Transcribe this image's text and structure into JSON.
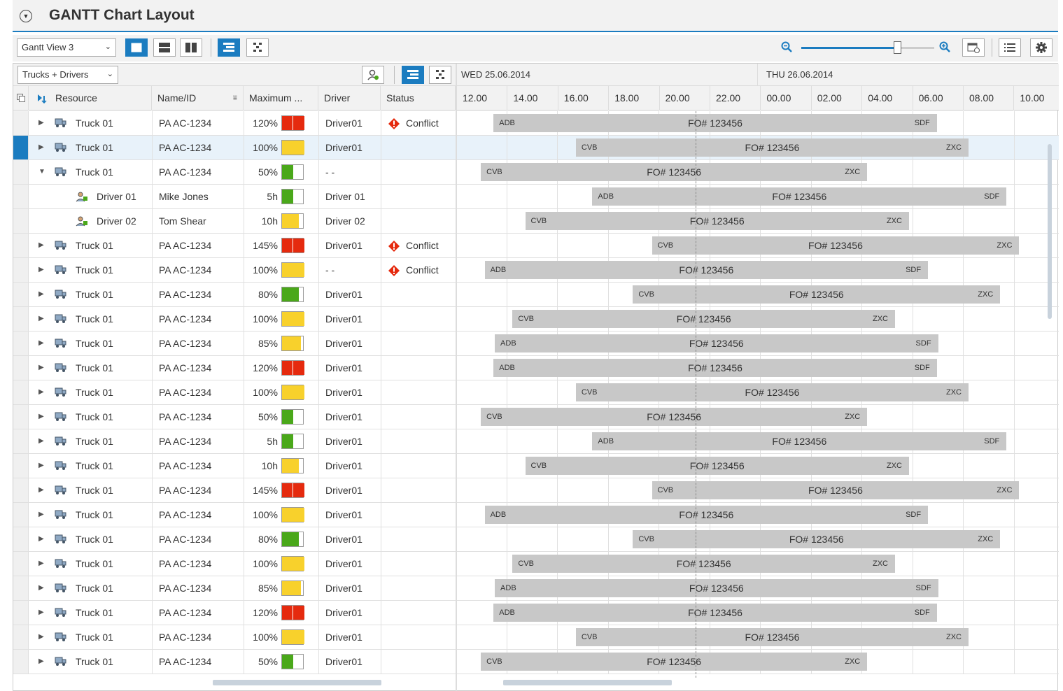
{
  "title": {
    "text": "GANTT Chart Layout",
    "toggle_icon": "chevron-down-circle-icon"
  },
  "toolbar": {
    "view_select": "Gantt View 3",
    "layout_buttons": [
      "single-panel-icon",
      "horizontal-split-icon",
      "vertical-split-icon"
    ],
    "mode_buttons": [
      "gantt-bars-icon",
      "network-icon"
    ],
    "right_icons": [
      "zoom-out-icon",
      "zoom-in-icon",
      "calendar-settings-icon",
      "list-icon",
      "settings-icon"
    ],
    "zoom_level": 0.72
  },
  "subtoolbar": {
    "filter_select": "Trucks + Drivers",
    "icons": [
      "assign-driver-icon",
      "gantt-bars-icon",
      "network-icon"
    ]
  },
  "columns": {
    "resource": "Resource",
    "name": "Name/ID",
    "maximum": "Maximum ...",
    "driver": "Driver",
    "status": "Status"
  },
  "days": [
    "WED 25.06.2014",
    "THU 26.06.2014"
  ],
  "hours": [
    "12.00",
    "14.00",
    "16.00",
    "18.00",
    "20.00",
    "22.00",
    "00.00",
    "02.00",
    "04.00",
    "06.00",
    "08.00",
    "10.00"
  ],
  "status_labels": {
    "conflict": "Conflict"
  },
  "colors": {
    "red": "#e52a0e",
    "yellow": "#f8d12c",
    "green": "#4aa81a",
    "accent": "#1b7cc0",
    "bar": "#c8c8c8"
  },
  "rows": [
    {
      "level": 0,
      "expander": "collapsed",
      "resource": "Truck 01",
      "name": "PA AC-1234",
      "max": "120%",
      "cap": "red",
      "capFill": 1.0,
      "driver": "Driver01",
      "status": "conflict",
      "bar": {
        "start": 1.25,
        "end": 18.75,
        "left": "ADB",
        "center": "FO# 123456",
        "right": "SDF"
      }
    },
    {
      "level": 0,
      "expander": "collapsed",
      "resource": "Truck 01",
      "name": "PA AC-1234",
      "max": "100%",
      "cap": "yellow",
      "capFill": 1.0,
      "driver": "Driver01",
      "status": "",
      "selected": true,
      "bar": {
        "start": 4.5,
        "end": 20.0,
        "left": "CVB",
        "center": "FO# 123456",
        "right": "ZXC"
      }
    },
    {
      "level": 0,
      "expander": "expanded",
      "resource": "Truck 01",
      "name": "PA AC-1234",
      "max": "50%",
      "cap": "green",
      "capFill": 0.5,
      "driver": "- -",
      "status": "",
      "bar": {
        "start": 0.75,
        "end": 16.0,
        "left": "CVB",
        "center": "FO# 123456",
        "right": "ZXC"
      }
    },
    {
      "level": 1,
      "expander": "none",
      "resource": "Driver 01",
      "name": "Mike Jones",
      "max": "5h",
      "cap": "green",
      "capFill": 0.5,
      "driver": "Driver 01",
      "status": "",
      "bar": {
        "start": 5.15,
        "end": 21.5,
        "left": "ADB",
        "center": "FO# 123456",
        "right": "SDF"
      }
    },
    {
      "level": 1,
      "expander": "none",
      "resource": "Driver 02",
      "name": "Tom Shear",
      "max": "10h",
      "cap": "yellow",
      "capFill": 0.75,
      "driver": "Driver 02",
      "status": "",
      "bar": {
        "start": 2.5,
        "end": 17.65,
        "left": "CVB",
        "center": "FO# 123456",
        "right": "ZXC"
      }
    },
    {
      "level": 0,
      "expander": "collapsed",
      "resource": "Truck 01",
      "name": "PA AC-1234",
      "max": "145%",
      "cap": "red",
      "capFill": 1.0,
      "driver": "Driver01",
      "status": "conflict",
      "bar": {
        "start": 7.5,
        "end": 22.0,
        "left": "CVB",
        "center": "FO# 123456",
        "right": "ZXC"
      }
    },
    {
      "level": 0,
      "expander": "collapsed",
      "resource": "Truck 01",
      "name": "PA AC-1234",
      "max": "100%",
      "cap": "yellow",
      "capFill": 1.0,
      "driver": "- -",
      "status": "conflict",
      "bar": {
        "start": 0.9,
        "end": 18.4,
        "left": "ADB",
        "center": "FO# 123456",
        "right": "SDF"
      }
    },
    {
      "level": 0,
      "expander": "collapsed",
      "resource": "Truck 01",
      "name": "PA AC-1234",
      "max": "80%",
      "cap": "green",
      "capFill": 0.75,
      "driver": "Driver01",
      "status": "",
      "bar": {
        "start": 6.75,
        "end": 21.25,
        "left": "CVB",
        "center": "FO# 123456",
        "right": "ZXC"
      }
    },
    {
      "level": 0,
      "expander": "collapsed",
      "resource": "Truck 01",
      "name": "PA AC-1234",
      "max": "100%",
      "cap": "yellow",
      "capFill": 1.0,
      "driver": "Driver01",
      "status": "",
      "bar": {
        "start": 2.0,
        "end": 17.1,
        "left": "CVB",
        "center": "FO# 123456",
        "right": "ZXC"
      }
    },
    {
      "level": 0,
      "expander": "collapsed",
      "resource": "Truck 01",
      "name": "PA AC-1234",
      "max": "85%",
      "cap": "yellow",
      "capFill": 0.85,
      "driver": "Driver01",
      "status": "",
      "bar": {
        "start": 1.3,
        "end": 18.8,
        "left": "ADB",
        "center": "FO# 123456",
        "right": "SDF"
      }
    },
    {
      "level": 0,
      "expander": "collapsed",
      "resource": "Truck 01",
      "name": "PA AC-1234",
      "max": "120%",
      "cap": "red",
      "capFill": 1.0,
      "driver": "Driver01",
      "status": "",
      "bar": {
        "start": 1.25,
        "end": 18.75,
        "left": "ADB",
        "center": "FO# 123456",
        "right": "SDF"
      }
    },
    {
      "level": 0,
      "expander": "collapsed",
      "resource": "Truck 01",
      "name": "PA AC-1234",
      "max": "100%",
      "cap": "yellow",
      "capFill": 1.0,
      "driver": "Driver01",
      "status": "",
      "bar": {
        "start": 4.5,
        "end": 20.0,
        "left": "CVB",
        "center": "FO# 123456",
        "right": "ZXC"
      }
    },
    {
      "level": 0,
      "expander": "collapsed",
      "resource": "Truck 01",
      "name": "PA AC-1234",
      "max": "50%",
      "cap": "green",
      "capFill": 0.5,
      "driver": "Driver01",
      "status": "",
      "bar": {
        "start": 0.75,
        "end": 16.0,
        "left": "CVB",
        "center": "FO# 123456",
        "right": "ZXC"
      }
    },
    {
      "level": 0,
      "expander": "collapsed",
      "resource": "Truck 01",
      "name": "PA AC-1234",
      "max": "5h",
      "cap": "green",
      "capFill": 0.5,
      "driver": "Driver01",
      "status": "",
      "bar": {
        "start": 5.15,
        "end": 21.5,
        "left": "ADB",
        "center": "FO# 123456",
        "right": "SDF"
      }
    },
    {
      "level": 0,
      "expander": "collapsed",
      "resource": "Truck 01",
      "name": "PA AC-1234",
      "max": "10h",
      "cap": "yellow",
      "capFill": 0.75,
      "driver": "Driver01",
      "status": "",
      "bar": {
        "start": 2.5,
        "end": 17.65,
        "left": "CVB",
        "center": "FO# 123456",
        "right": "ZXC"
      }
    },
    {
      "level": 0,
      "expander": "collapsed",
      "resource": "Truck 01",
      "name": "PA AC-1234",
      "max": "145%",
      "cap": "red",
      "capFill": 1.0,
      "driver": "Driver01",
      "status": "",
      "bar": {
        "start": 7.5,
        "end": 22.0,
        "left": "CVB",
        "center": "FO# 123456",
        "right": "ZXC"
      }
    },
    {
      "level": 0,
      "expander": "collapsed",
      "resource": "Truck 01",
      "name": "PA AC-1234",
      "max": "100%",
      "cap": "yellow",
      "capFill": 1.0,
      "driver": "Driver01",
      "status": "",
      "bar": {
        "start": 0.9,
        "end": 18.4,
        "left": "ADB",
        "center": "FO# 123456",
        "right": "SDF"
      }
    },
    {
      "level": 0,
      "expander": "collapsed",
      "resource": "Truck 01",
      "name": "PA AC-1234",
      "max": "80%",
      "cap": "green",
      "capFill": 0.75,
      "driver": "Driver01",
      "status": "",
      "bar": {
        "start": 6.75,
        "end": 21.25,
        "left": "CVB",
        "center": "FO# 123456",
        "right": "ZXC"
      }
    },
    {
      "level": 0,
      "expander": "collapsed",
      "resource": "Truck 01",
      "name": "PA AC-1234",
      "max": "100%",
      "cap": "yellow",
      "capFill": 1.0,
      "driver": "Driver01",
      "status": "",
      "bar": {
        "start": 2.0,
        "end": 17.1,
        "left": "CVB",
        "center": "FO# 123456",
        "right": "ZXC"
      }
    },
    {
      "level": 0,
      "expander": "collapsed",
      "resource": "Truck 01",
      "name": "PA AC-1234",
      "max": "85%",
      "cap": "yellow",
      "capFill": 0.85,
      "driver": "Driver01",
      "status": "",
      "bar": {
        "start": 1.3,
        "end": 18.8,
        "left": "ADB",
        "center": "FO# 123456",
        "right": "SDF"
      }
    },
    {
      "level": 0,
      "expander": "collapsed",
      "resource": "Truck 01",
      "name": "PA AC-1234",
      "max": "120%",
      "cap": "red",
      "capFill": 1.0,
      "driver": "Driver01",
      "status": "",
      "bar": {
        "start": 1.25,
        "end": 18.75,
        "left": "ADB",
        "center": "FO# 123456",
        "right": "SDF"
      }
    },
    {
      "level": 0,
      "expander": "collapsed",
      "resource": "Truck 01",
      "name": "PA AC-1234",
      "max": "100%",
      "cap": "yellow",
      "capFill": 1.0,
      "driver": "Driver01",
      "status": "",
      "bar": {
        "start": 4.5,
        "end": 20.0,
        "left": "CVB",
        "center": "FO# 123456",
        "right": "ZXC"
      }
    },
    {
      "level": 0,
      "expander": "collapsed",
      "resource": "Truck 01",
      "name": "PA AC-1234",
      "max": "50%",
      "cap": "green",
      "capFill": 0.5,
      "driver": "Driver01",
      "status": "",
      "bar": {
        "start": 0.75,
        "end": 16.0,
        "left": "CVB",
        "center": "FO# 123456",
        "right": "ZXC"
      }
    }
  ]
}
